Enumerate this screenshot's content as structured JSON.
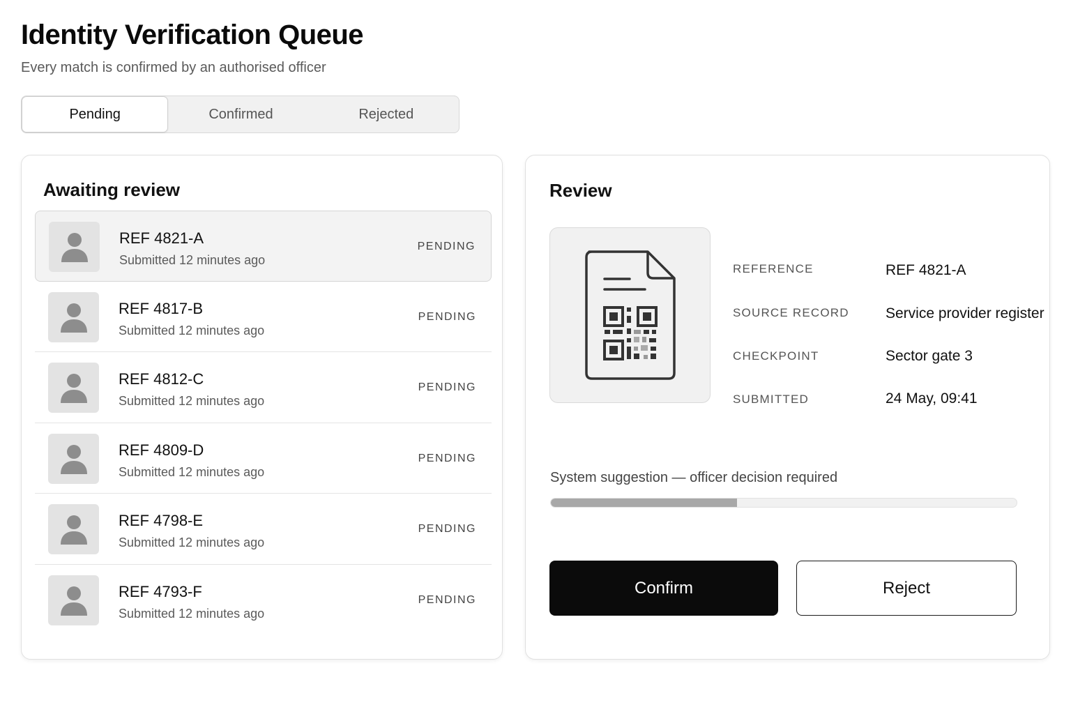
{
  "header": {
    "title": "Identity Verification Queue",
    "subtitle": "Every match is confirmed by an authorised officer"
  },
  "tabs": [
    {
      "label": "Pending",
      "active": true
    },
    {
      "label": "Confirmed",
      "active": false
    },
    {
      "label": "Rejected",
      "active": false
    }
  ],
  "queue": {
    "title": "Awaiting review",
    "items": [
      {
        "ref": "REF 4821-A",
        "time": "Submitted 12 minutes ago",
        "status": "PENDING",
        "selected": true
      },
      {
        "ref": "REF 4817-B",
        "time": "Submitted 12 minutes ago",
        "status": "PENDING",
        "selected": false
      },
      {
        "ref": "REF 4812-C",
        "time": "Submitted 12 minutes ago",
        "status": "PENDING",
        "selected": false
      },
      {
        "ref": "REF 4809-D",
        "time": "Submitted 12 minutes ago",
        "status": "PENDING",
        "selected": false
      },
      {
        "ref": "REF 4798-E",
        "time": "Submitted 12 minutes ago",
        "status": "PENDING",
        "selected": false
      },
      {
        "ref": "REF 4793-F",
        "time": "Submitted 12 minutes ago",
        "status": "PENDING",
        "selected": false
      }
    ]
  },
  "review": {
    "title": "Review",
    "document_icon": "document-qr-icon",
    "fields": [
      {
        "label": "REFERENCE",
        "value": "REF 4821-A"
      },
      {
        "label": "SOURCE RECORD",
        "value": "Service provider register"
      },
      {
        "label": "CHECKPOINT",
        "value": "Sector gate 3"
      },
      {
        "label": "SUBMITTED",
        "value": "24 May, 09:41"
      }
    ],
    "suggestion": "System suggestion — officer decision required",
    "suggestion_progress": 0.4,
    "confirm_label": "Confirm",
    "reject_label": "Reject"
  },
  "colors": {
    "primary_button": "#0b0b0b",
    "progress_fill": "#a8a8a8",
    "avatar_bg": "#e3e3e3"
  }
}
